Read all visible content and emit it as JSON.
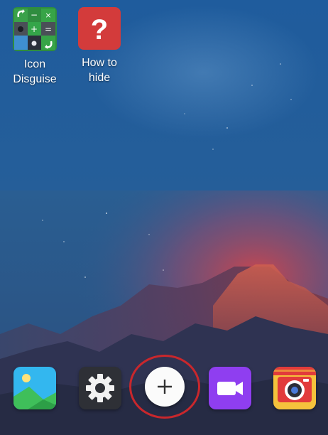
{
  "home_screen": {
    "apps": [
      {
        "label": "Icon\nDisguise",
        "icon": "calculator-disguise-icon"
      },
      {
        "label": "How to hide",
        "icon": "question-mark-icon"
      }
    ]
  },
  "dock": {
    "items": [
      {
        "icon": "gallery-icon"
      },
      {
        "icon": "settings-gear-icon"
      },
      {
        "icon": "add-icon"
      },
      {
        "icon": "video-camera-icon"
      },
      {
        "icon": "camera-icon"
      }
    ],
    "highlighted_item": "add-icon"
  },
  "colors": {
    "sky_top": "#22609f",
    "sky_mid": "#2b5f96",
    "glow": "#c8474c",
    "mountain": "#3f3a5a",
    "highlight_ring": "#c9272c",
    "question_bg": "#d33b3b",
    "video_bg": "#8f3ef0",
    "camera_bg": "#f5c23c"
  }
}
